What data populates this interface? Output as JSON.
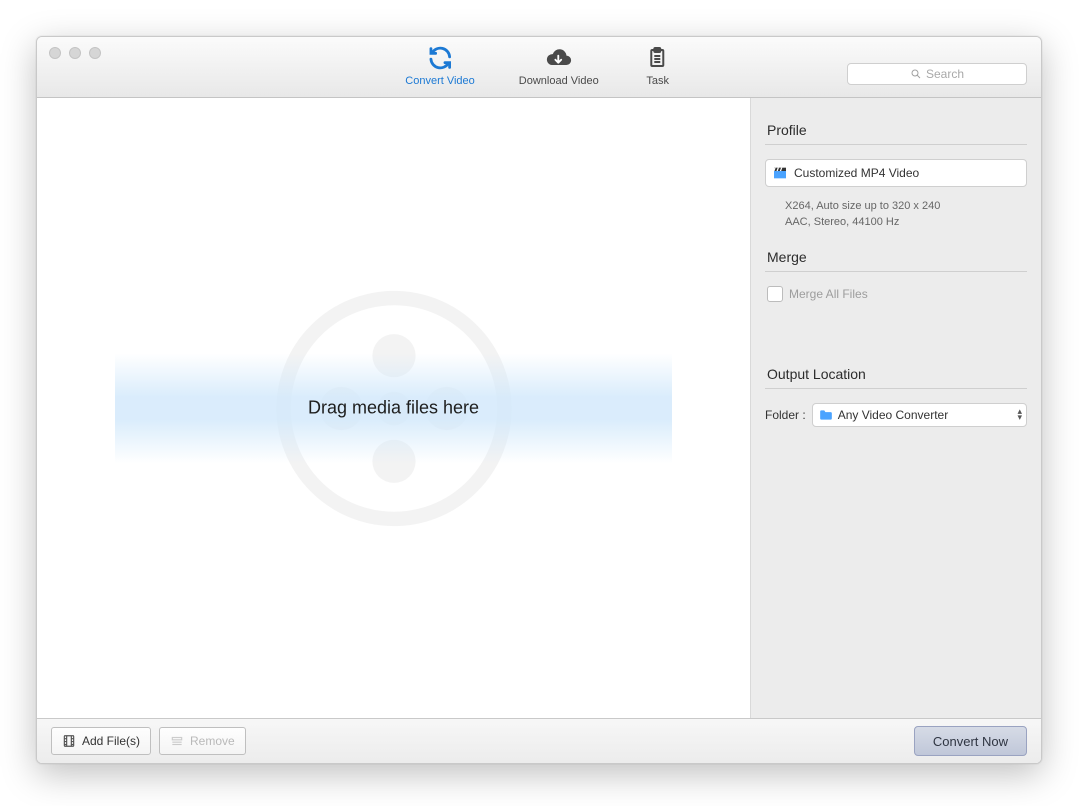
{
  "toolbar": {
    "convert_tab": "Convert Video",
    "download_tab": "Download Video",
    "task_tab": "Task"
  },
  "search": {
    "placeholder": "Search"
  },
  "main": {
    "drop_text": "Drag media files here"
  },
  "sidebar": {
    "profile_header": "Profile",
    "profile_name": "Customized MP4 Video",
    "profile_line1": "X264, Auto size up to 320 x 240",
    "profile_line2": "AAC, Stereo, 44100 Hz",
    "merge_header": "Merge",
    "merge_label": "Merge All Files",
    "output_header": "Output Location",
    "folder_label": "Folder :",
    "folder_value": "Any Video Converter"
  },
  "footer": {
    "add_label": "Add File(s)",
    "remove_label": "Remove",
    "convert_label": "Convert Now"
  }
}
